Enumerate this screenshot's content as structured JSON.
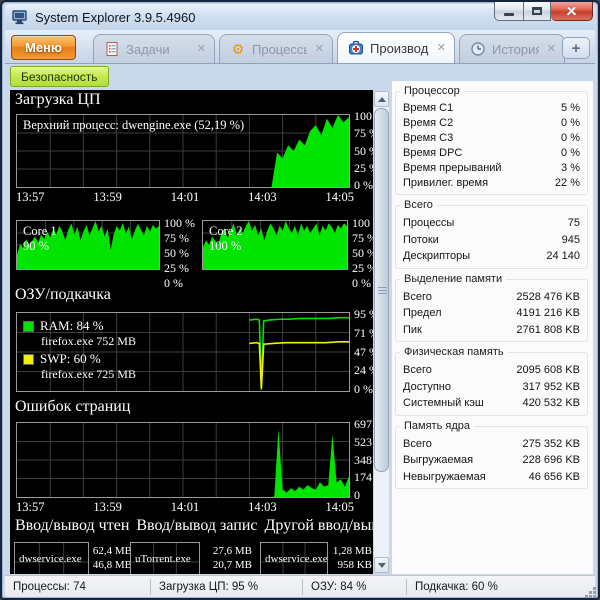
{
  "window": {
    "title": "System Explorer 3.9.5.4960"
  },
  "icons": {
    "tab_close": "✕",
    "add_tab": "+",
    "gear": "⚙"
  },
  "menu_button": "Меню",
  "tabs": [
    {
      "label": "Задачи"
    },
    {
      "label": "Процессы"
    },
    {
      "label": "Производи..."
    },
    {
      "label": "История"
    }
  ],
  "toolbar": {
    "security": "Безопасность"
  },
  "axis": {
    "percent": [
      "100 %",
      "75 %",
      "50 %",
      "25 %",
      "0 %"
    ],
    "mem": [
      "95 %",
      "71 %",
      "47 %",
      "24 %",
      "0 %"
    ],
    "pf": [
      "697",
      "523",
      "348",
      "174",
      "0"
    ],
    "time": [
      "13:57",
      "13:59",
      "14:01",
      "14:03",
      "14:05"
    ]
  },
  "cpu": {
    "title": "Загрузка ЦП",
    "top_process": "Верхний процесс: dwengine.exe (52,19 %)"
  },
  "cores": [
    {
      "name": "Core 1",
      "value": "90 %"
    },
    {
      "name": "Core 2",
      "value": "100 %"
    }
  ],
  "memory": {
    "title": "ОЗУ/подкачка",
    "legend": [
      {
        "label": "RAM: 84 %",
        "process": "firefox.exe 752 MB"
      },
      {
        "label": "SWP: 60 %",
        "process": "firefox.exe 725 MB"
      }
    ]
  },
  "page_faults": {
    "title": "Ошибок страниц"
  },
  "io": {
    "headers": [
      "Ввод/вывод чтен",
      "Ввод/вывод запис",
      "Другой ввод/выв"
    ],
    "items": [
      {
        "process": "dwservice.exe",
        "scale_top": "62,4 MB",
        "scale_mid": "46,8 MB"
      },
      {
        "process": "uTorrent.exe",
        "scale_top": "27,6 MB",
        "scale_mid": "20,7 MB"
      },
      {
        "process": "dwservice.exe",
        "scale_top": "1,28 MB",
        "scale_mid": "958 KB"
      }
    ]
  },
  "stats": {
    "sections": [
      {
        "title": "Процессор",
        "rows": [
          {
            "l": "Время C1",
            "v": "5 %"
          },
          {
            "l": "Время C2",
            "v": "0 %"
          },
          {
            "l": "Время C3",
            "v": "0 %"
          },
          {
            "l": "Время DPC",
            "v": "0 %"
          },
          {
            "l": "Время прерываний",
            "v": "3 %"
          },
          {
            "l": "Привилег. время",
            "v": "22 %"
          }
        ]
      },
      {
        "title": "Всего",
        "rows": [
          {
            "l": "Процессы",
            "v": "75"
          },
          {
            "l": "Потоки",
            "v": "945"
          },
          {
            "l": "Дескрипторы",
            "v": "24 140"
          }
        ]
      },
      {
        "title": "Выделение памяти",
        "rows": [
          {
            "l": "Всего",
            "v": "2528 476 KB"
          },
          {
            "l": "Предел",
            "v": "4191 216 KB"
          },
          {
            "l": "Пик",
            "v": "2761 808 KB"
          }
        ]
      },
      {
        "title": "Физическая память",
        "rows": [
          {
            "l": "Всего",
            "v": "2095 608 KB"
          },
          {
            "l": "Доступно",
            "v": "317 952 KB"
          },
          {
            "l": "Системный кэш",
            "v": "420 532 KB"
          }
        ]
      },
      {
        "title": "Память ядра",
        "rows": [
          {
            "l": "Всего",
            "v": "275 352 KB"
          },
          {
            "l": "Выгружаемая",
            "v": "228 696 KB"
          },
          {
            "l": "Невыгружаемая",
            "v": "46 656 KB"
          }
        ]
      }
    ]
  },
  "status": {
    "items": [
      "Процессы: 74",
      "Загрузка ЦП: 95 %",
      "ОЗУ: 84 %",
      "Подкачка: 60 %"
    ]
  },
  "colors": {
    "graph_green": "#00e400",
    "graph_yellow": "#f0f000",
    "grid": "#3e3e3e",
    "accent_orange": "#ee8a21",
    "accent_lime": "#bfe84a",
    "status_red": "#c6402c"
  },
  "graphs": {
    "cpu_total": {
      "vlines": 10,
      "hlines": 4,
      "series": [
        {
          "type": "area",
          "color": "#00e400",
          "values": [
            0,
            0,
            0,
            0,
            0,
            0,
            0,
            0,
            0,
            0,
            0,
            0,
            0,
            0,
            0,
            0,
            0,
            0,
            0,
            0,
            0,
            0,
            0,
            0,
            0,
            0,
            0,
            0,
            0,
            0,
            0,
            0,
            0,
            0,
            0,
            0,
            0,
            0,
            0,
            0,
            0,
            0,
            0,
            0,
            0,
            0,
            0,
            0.48,
            0.4,
            0.58,
            0.5,
            0.66,
            0.58,
            0.78,
            0.86,
            0.72,
            0.95,
            0.82,
            1,
            0.9,
            0.97
          ]
        }
      ]
    },
    "core1": {
      "vlines": 5,
      "hlines": 4,
      "series": [
        {
          "type": "area",
          "color": "#00e400",
          "values": [
            0.3,
            0.52,
            0.44,
            0.62,
            0.5,
            0.58,
            0.68,
            0.55,
            0.72,
            0.62,
            0.78,
            0.66,
            0.84,
            0.72,
            0.9,
            0.78,
            0.6,
            0.82,
            0.95,
            0.72,
            0.88,
            0.6,
            0.78,
            0.92,
            0.7,
            0.85,
            1,
            0.78,
            0.9,
            0.68,
            0.84,
            0.4,
            0.72,
            0.9,
            0.8,
            0.96,
            0.74,
            0.88,
            0.62,
            0.8,
            0.94,
            0.82,
            0.7,
            0.9,
            0.78,
            0.92,
            0.84,
            0.9
          ]
        }
      ]
    },
    "core2": {
      "vlines": 5,
      "hlines": 4,
      "series": [
        {
          "type": "area",
          "color": "#00e400",
          "values": [
            0.45,
            0.6,
            0.5,
            0.68,
            0.58,
            0.52,
            0.75,
            0.85,
            0.65,
            0.8,
            0.95,
            0.7,
            0.85,
            0.75,
            0.9,
            1,
            0.8,
            0.92,
            0.7,
            0.85,
            0.6,
            0.8,
            0.95,
            0.85,
            0.7,
            0.9,
            0.8,
            1,
            0.85,
            0.75,
            0.9,
            0.7,
            0.95,
            0.8,
            0.9,
            0.75,
            0.85,
            0.95,
            0.7,
            0.9,
            0.8,
            0.95,
            0.88,
            0.75,
            0.92,
            0.85,
            0.95,
            0.9
          ]
        }
      ]
    },
    "ram_swap": {
      "vlines": 10,
      "hlines": 4,
      "series": [
        {
          "type": "line",
          "color": "#00e400",
          "points": [
            [
              70,
              91
            ],
            [
              72,
              92
            ],
            [
              73,
              91
            ],
            [
              73.6,
              4
            ],
            [
              74.3,
              90
            ],
            [
              76,
              91
            ],
            [
              79,
              92
            ],
            [
              82,
              92
            ],
            [
              85,
              93
            ],
            [
              88,
              93
            ],
            [
              91,
              93
            ],
            [
              94,
              93
            ],
            [
              97,
              94
            ],
            [
              100,
              94
            ]
          ]
        },
        {
          "type": "line",
          "color": "#f0f000",
          "points": [
            [
              70,
              61
            ],
            [
              72,
              62
            ],
            [
              73,
              61
            ],
            [
              73.6,
              2
            ],
            [
              74.3,
              60
            ],
            [
              77,
              61
            ],
            [
              81,
              62
            ],
            [
              85,
              62
            ],
            [
              89,
              62
            ],
            [
              93,
              62
            ],
            [
              97,
              63
            ],
            [
              100,
              63
            ]
          ]
        }
      ]
    },
    "page_faults": {
      "vlines": 10,
      "hlines": 4,
      "series": [
        {
          "type": "area",
          "color": "#00e400",
          "values": [
            0,
            0,
            0,
            0,
            0,
            0,
            0,
            0,
            0,
            0,
            0,
            0,
            0,
            0,
            0,
            0,
            0,
            0,
            0,
            0,
            0,
            0,
            0,
            0,
            0,
            0,
            0,
            0,
            0,
            0,
            0,
            0,
            0,
            0,
            0,
            0,
            0,
            0,
            0,
            0,
            0,
            0,
            0,
            0,
            0,
            0,
            0,
            0,
            0,
            0,
            0,
            0,
            0,
            0,
            0,
            0,
            0,
            0,
            0,
            0,
            0,
            0,
            0,
            0.92,
            0.1,
            0.06,
            0.12,
            0.08,
            0.14,
            0.1,
            0.16,
            0.12,
            0.1,
            0.2,
            0.14,
            0.16,
            0.85,
            0.2,
            0.24,
            0.14,
            0.28
          ]
        }
      ]
    },
    "io0": {
      "vlines": 3,
      "hlines": 2,
      "series": [
        {
          "type": "area",
          "color": "#00e400",
          "values": [
            0.06,
            0.12,
            0.08,
            0.15,
            0.1,
            0.07,
            0.13,
            0.09,
            0.14,
            0.1
          ]
        }
      ]
    },
    "io1": {
      "vlines": 3,
      "hlines": 2,
      "series": [
        {
          "type": "area",
          "color": "#00e400",
          "values": [
            0.05,
            0.1,
            0.07,
            0.12,
            0.09,
            0.06,
            0.11,
            0.08,
            0.13,
            0.09
          ]
        }
      ]
    },
    "io2": {
      "vlines": 3,
      "hlines": 2,
      "series": [
        {
          "type": "area",
          "color": "#00e400",
          "values": [
            0.04,
            0.09,
            0.06,
            0.11,
            0.07,
            0.05,
            0.1,
            0.07,
            0.12,
            0.08
          ]
        }
      ]
    }
  }
}
